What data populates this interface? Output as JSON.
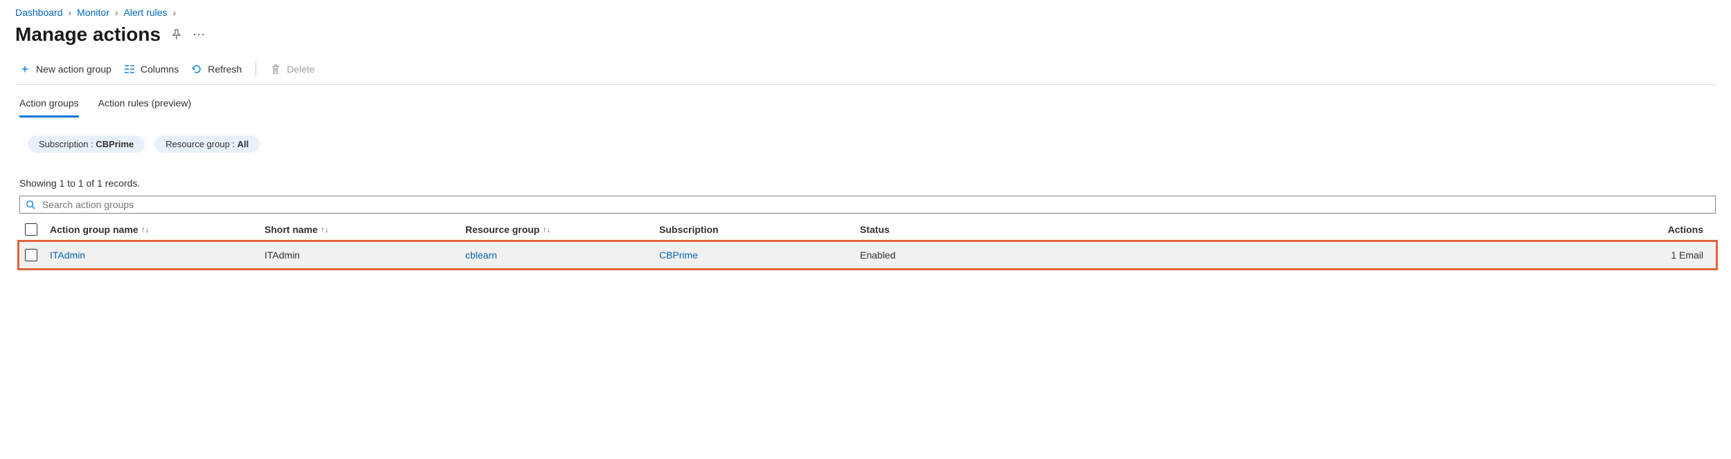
{
  "breadcrumb": {
    "items": [
      "Dashboard",
      "Monitor",
      "Alert rules"
    ]
  },
  "title": "Manage actions",
  "toolbar": {
    "new_group": "New action group",
    "columns": "Columns",
    "refresh": "Refresh",
    "delete": "Delete"
  },
  "tabs": {
    "action_groups": "Action groups",
    "action_rules": "Action rules (preview)"
  },
  "filters": {
    "sub_label": "Subscription : ",
    "sub_value": "CBPrime",
    "rg_label": "Resource group : ",
    "rg_value": "All"
  },
  "records_text": "Showing 1 to 1 of 1 records.",
  "search": {
    "placeholder": "Search action groups"
  },
  "columns": {
    "name": "Action group name",
    "short": "Short name",
    "rg": "Resource group",
    "sub": "Subscription",
    "status": "Status",
    "actions": "Actions"
  },
  "rows": [
    {
      "name": "ITAdmin",
      "short": "ITAdmin",
      "rg": "cblearn",
      "sub": "CBPrime",
      "status": "Enabled",
      "actions": "1 Email"
    }
  ]
}
